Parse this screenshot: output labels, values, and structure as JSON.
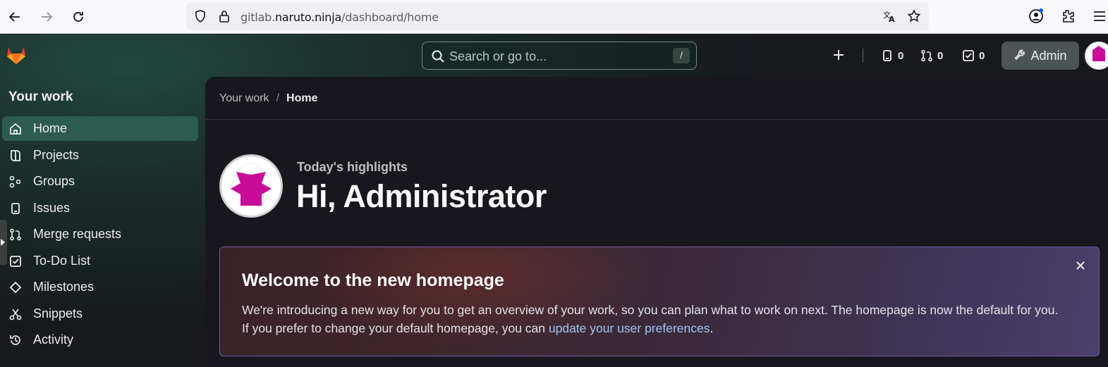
{
  "browser": {
    "url_prefix": "gitlab.",
    "url_host": "naruto.ninja",
    "url_path": "/dashboard/home"
  },
  "topbar": {
    "search_placeholder": "Search or go to...",
    "search_shortcut": "/",
    "issues_count": "0",
    "merge_requests_count": "0",
    "todos_count": "0",
    "admin_label": "Admin"
  },
  "sidebar": {
    "title": "Your work",
    "items": [
      {
        "label": "Home",
        "icon": "home-icon",
        "active": true
      },
      {
        "label": "Projects",
        "icon": "project-icon"
      },
      {
        "label": "Groups",
        "icon": "group-icon"
      },
      {
        "label": "Issues",
        "icon": "issues-icon"
      },
      {
        "label": "Merge requests",
        "icon": "merge-request-icon"
      },
      {
        "label": "To-Do List",
        "icon": "todo-icon"
      },
      {
        "label": "Milestones",
        "icon": "milestone-icon"
      },
      {
        "label": "Snippets",
        "icon": "snippet-icon"
      },
      {
        "label": "Activity",
        "icon": "history-icon"
      }
    ]
  },
  "main": {
    "breadcrumb": [
      "Your work",
      "Home"
    ],
    "highlight_label": "Today's highlights",
    "greeting": "Hi, Administrator",
    "banner": {
      "title": "Welcome to the new homepage",
      "text": "We're introducing a new way for you to get an overview of your work, so you can plan what to work on next. The homepage is now the default for you. If you prefer to change your default homepage, you can ",
      "link": "update your user preferences",
      "text_end": "."
    }
  },
  "colors": {
    "accent": "#2c5b4f",
    "avatar": "#c90d9b",
    "link": "#9dc7f1",
    "banner_border": "#6f5aa7"
  }
}
